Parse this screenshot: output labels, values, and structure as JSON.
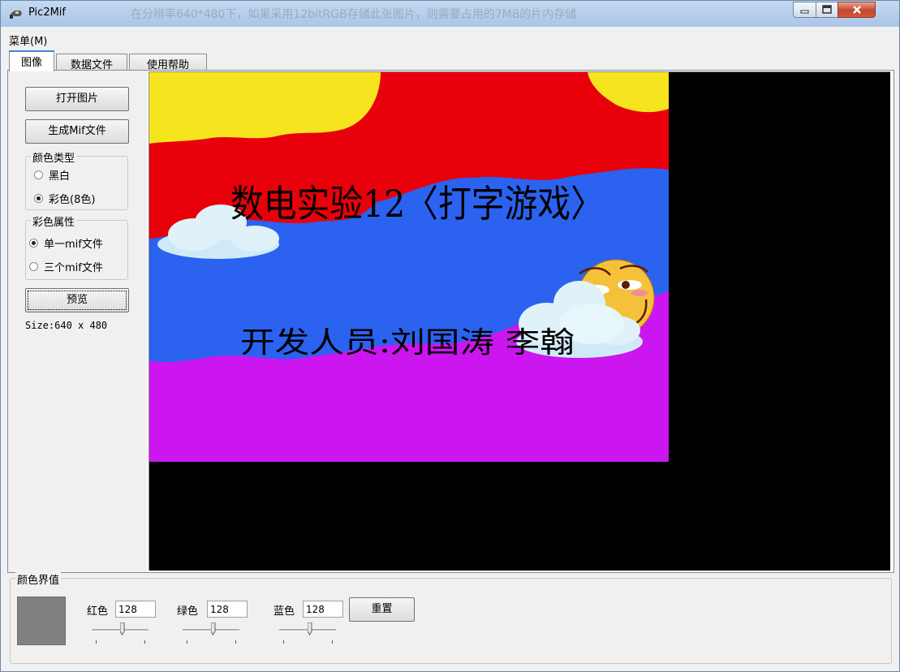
{
  "window": {
    "title": "Pic2Mif",
    "ghost_text": "在分辨率640*480下，如果采用12bitRGB存储此张图片，则需要占用的7MB的片内存储",
    "controls": {
      "minimize": "minimize-icon",
      "maximize": "maximize-icon",
      "close": "close-icon"
    }
  },
  "menu": {
    "label": "菜单(M)"
  },
  "tabs": [
    {
      "label": "图像",
      "active": true
    },
    {
      "label": "数据文件",
      "active": false
    },
    {
      "label": "使用帮助",
      "active": false
    }
  ],
  "left": {
    "open_button": "打开图片",
    "generate_button": "生成Mif文件",
    "color_type": {
      "legend": "颜色类型",
      "options": [
        {
          "label": "黑白",
          "checked": false
        },
        {
          "label": "彩色(8色)",
          "checked": true
        }
      ]
    },
    "color_attr": {
      "legend": "彩色属性",
      "options": [
        {
          "label": "单一mif文件",
          "checked": true
        },
        {
          "label": "三个mif文件",
          "checked": false
        }
      ]
    },
    "preview_button": "预览",
    "size_text": "Size:640 x 480"
  },
  "image": {
    "title": "数电实验12〈打字游戏〉",
    "developers": "开发人员:刘国涛  李翰",
    "colors": {
      "red": "#e8000b",
      "yellow": "#f5e41e",
      "blue": "#2b62f0",
      "purple": "#cc16f0",
      "black": "#000000"
    }
  },
  "threshold": {
    "legend": "颜色界值",
    "swatch_color": "#808080",
    "red": {
      "label": "红色",
      "value": "128",
      "slider": 0.5
    },
    "green": {
      "label": "绿色",
      "value": "128",
      "slider": 0.5
    },
    "blue": {
      "label": "蓝色",
      "value": "128",
      "slider": 0.5
    },
    "reset_button": "重置"
  }
}
